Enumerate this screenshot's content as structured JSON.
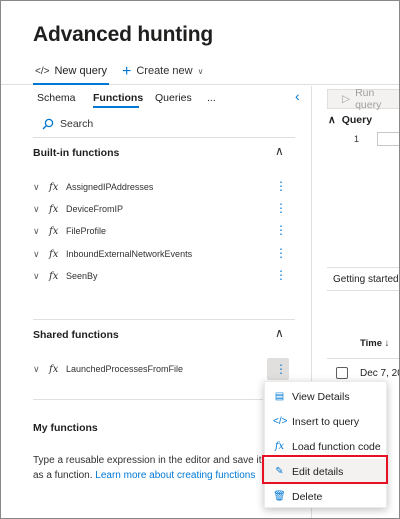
{
  "page": {
    "title": "Advanced hunting"
  },
  "toolbar": {
    "new_query": "New query",
    "create_new": "Create new"
  },
  "tabs": {
    "schema": "Schema",
    "functions": "Functions",
    "queries": "Queries",
    "more": "..."
  },
  "search": {
    "placeholder": "Search"
  },
  "builtin": {
    "title": "Built-in functions",
    "items": [
      "AssignedIPAddresses",
      "DeviceFromIP",
      "FileProfile",
      "InboundExternalNetworkEvents",
      "SeenBy"
    ]
  },
  "shared": {
    "title": "Shared functions",
    "items": [
      "LaunchedProcessesFromFile"
    ]
  },
  "myfunctions": {
    "title": "My functions",
    "text": "Type a reusable expression in the editor and save it as a function.",
    "link": "Learn more about creating functions"
  },
  "editor": {
    "run_query": "Run query",
    "query_label": "Query",
    "line_number": "1",
    "getting_started": "Getting started",
    "time_header": "Time ↓",
    "first_date": "Dec 7, 20"
  },
  "context_menu": {
    "items": [
      {
        "label": "View Details",
        "icon": "document-icon"
      },
      {
        "label": "Insert to query",
        "icon": "code-icon"
      },
      {
        "label": "Load function code",
        "icon": "fx-icon"
      },
      {
        "label": "Edit details",
        "icon": "edit-icon"
      },
      {
        "label": "Delete",
        "icon": "delete-icon"
      }
    ]
  },
  "colors": {
    "accent": "#0078d4",
    "highlight": "#e81123"
  }
}
